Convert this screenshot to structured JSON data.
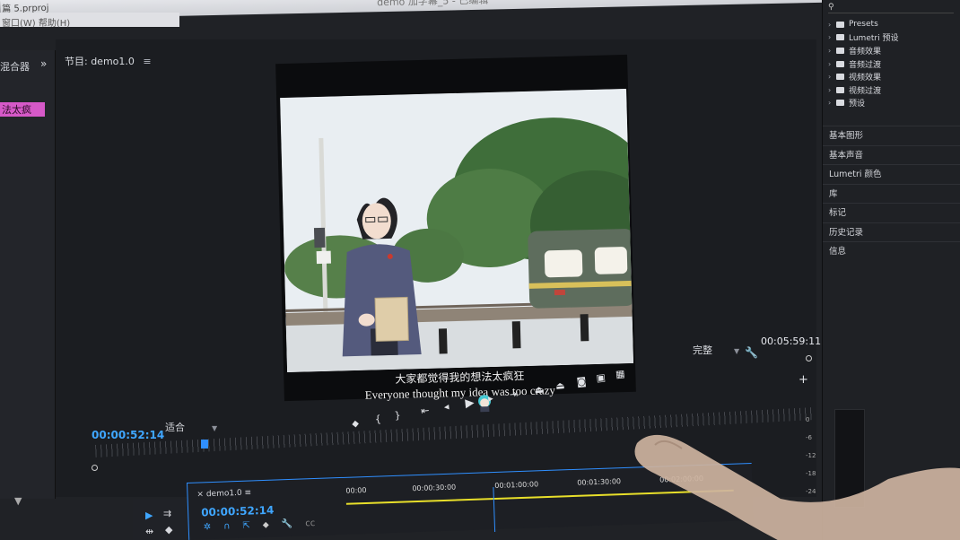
{
  "window": {
    "project_file": "篇 5.prproj",
    "document_title": "demo 加字幕_5 - 已编辑",
    "menu_text": "窗口(W)   帮助(H)"
  },
  "left_panel": {
    "title": "混合器",
    "chevron": "»",
    "clip_label": "法太疯"
  },
  "monitor": {
    "label": "节目: demo1.0",
    "menu_glyph": "≡",
    "timecode_current": "00:00:52:14",
    "fit": "适合",
    "quality": "完整",
    "timecode_duration": "00:05:59:11",
    "subtitle_zh": "大家都觉得我的想法太疯狂",
    "subtitle_en": "Everyone thought my idea was too crazy"
  },
  "effects": {
    "items": [
      "Presets",
      "Lumetri 预设",
      "音频效果",
      "音频过渡",
      "视频效果",
      "视频过渡",
      "预设"
    ]
  },
  "panels": [
    "基本图形",
    "基本声音",
    "Lumetri 颜色",
    "库",
    "标记",
    "历史记录",
    "信息"
  ],
  "meter_scale": [
    "0",
    "-6",
    "-12",
    "-18",
    "-24"
  ],
  "timeline": {
    "sequence": "demo1.0",
    "timecode": "00:00:52:14",
    "ruler": [
      "00:00",
      "00:00:30:00",
      "00:01:00:00",
      "00:01:30:00",
      "00:02:00:00"
    ]
  },
  "colors": {
    "accent": "#2f8fff",
    "timecode": "#3fa6ff",
    "clip": "#d659c8",
    "work_area": "#e8df2a"
  }
}
